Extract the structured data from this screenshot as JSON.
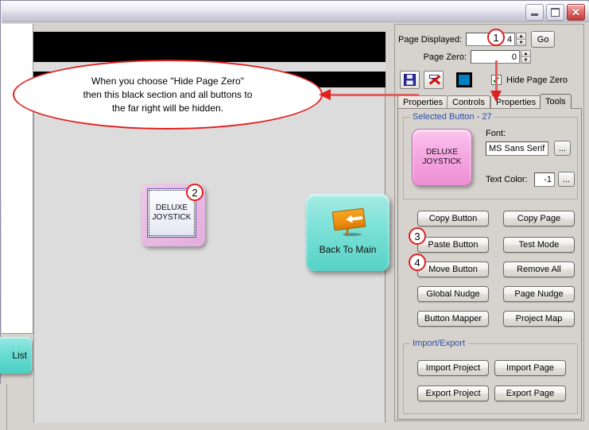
{
  "window": {
    "title": "",
    "buttons": {
      "minimize": "_",
      "maximize": "□",
      "close": "✕"
    }
  },
  "annotations": {
    "callout_text": "When you choose \"Hide Page Zero\" then this black section and all buttons to the far right will be hidden.",
    "callout_line1": "When you choose \"Hide Page Zero\"",
    "callout_line2": "then this black section and all buttons to",
    "callout_line3": "the far right will be hidden.",
    "markers": [
      "1",
      "2",
      "3",
      "4"
    ],
    "color": "#e02020"
  },
  "canvas": {
    "joystick_button": {
      "line1": "DELUXE",
      "line2": "JOYSTICK",
      "marker": "2"
    },
    "back_button": {
      "label": "Back To Main",
      "icon": "sign-arrow-left-icon"
    },
    "list_button": {
      "label": "List"
    }
  },
  "toolbar": {
    "page_displayed_label": "Page Displayed:",
    "page_displayed_value": "4",
    "page_zero_label": "Page Zero:",
    "page_zero_value": "0",
    "go_label": "Go",
    "save_icon": "floppy-disk-icon",
    "delete_icon": "red-x-icon",
    "color_swatch": "#0080c0",
    "hide_page_zero_label": "Hide Page Zero",
    "hide_page_zero_checked": "✔"
  },
  "tabs": [
    {
      "label": "Properties",
      "selected": false
    },
    {
      "label": "Controls",
      "selected": false
    },
    {
      "label": "Properties",
      "selected": false
    },
    {
      "label": "Tools",
      "selected": true
    }
  ],
  "selected_button_group": {
    "title": "Selected Button - 27",
    "preview_line1": "DELUXE",
    "preview_line2": "JOYSTICK",
    "font_label": "Font:",
    "font_value": "MS Sans Serif",
    "font_browse": "...",
    "text_color_label": "Text Color:",
    "text_color_value": "-1",
    "text_color_browse": "..."
  },
  "tool_buttons": [
    {
      "label": "Copy Button",
      "marker": "3"
    },
    {
      "label": "Copy Page",
      "marker": ""
    },
    {
      "label": "Paste Button",
      "marker": "4"
    },
    {
      "label": "Test Mode",
      "marker": ""
    },
    {
      "label": "Move Button",
      "marker": ""
    },
    {
      "label": "Remove All",
      "marker": ""
    },
    {
      "label": "Global Nudge",
      "marker": ""
    },
    {
      "label": "Page Nudge",
      "marker": ""
    },
    {
      "label": "Button Mapper",
      "marker": ""
    },
    {
      "label": "Project Map",
      "marker": ""
    }
  ],
  "import_export": {
    "title": "Import/Export",
    "buttons": [
      {
        "label": "Import Project"
      },
      {
        "label": "Import Page"
      },
      {
        "label": "Export Project"
      },
      {
        "label": "Export Page"
      }
    ]
  }
}
